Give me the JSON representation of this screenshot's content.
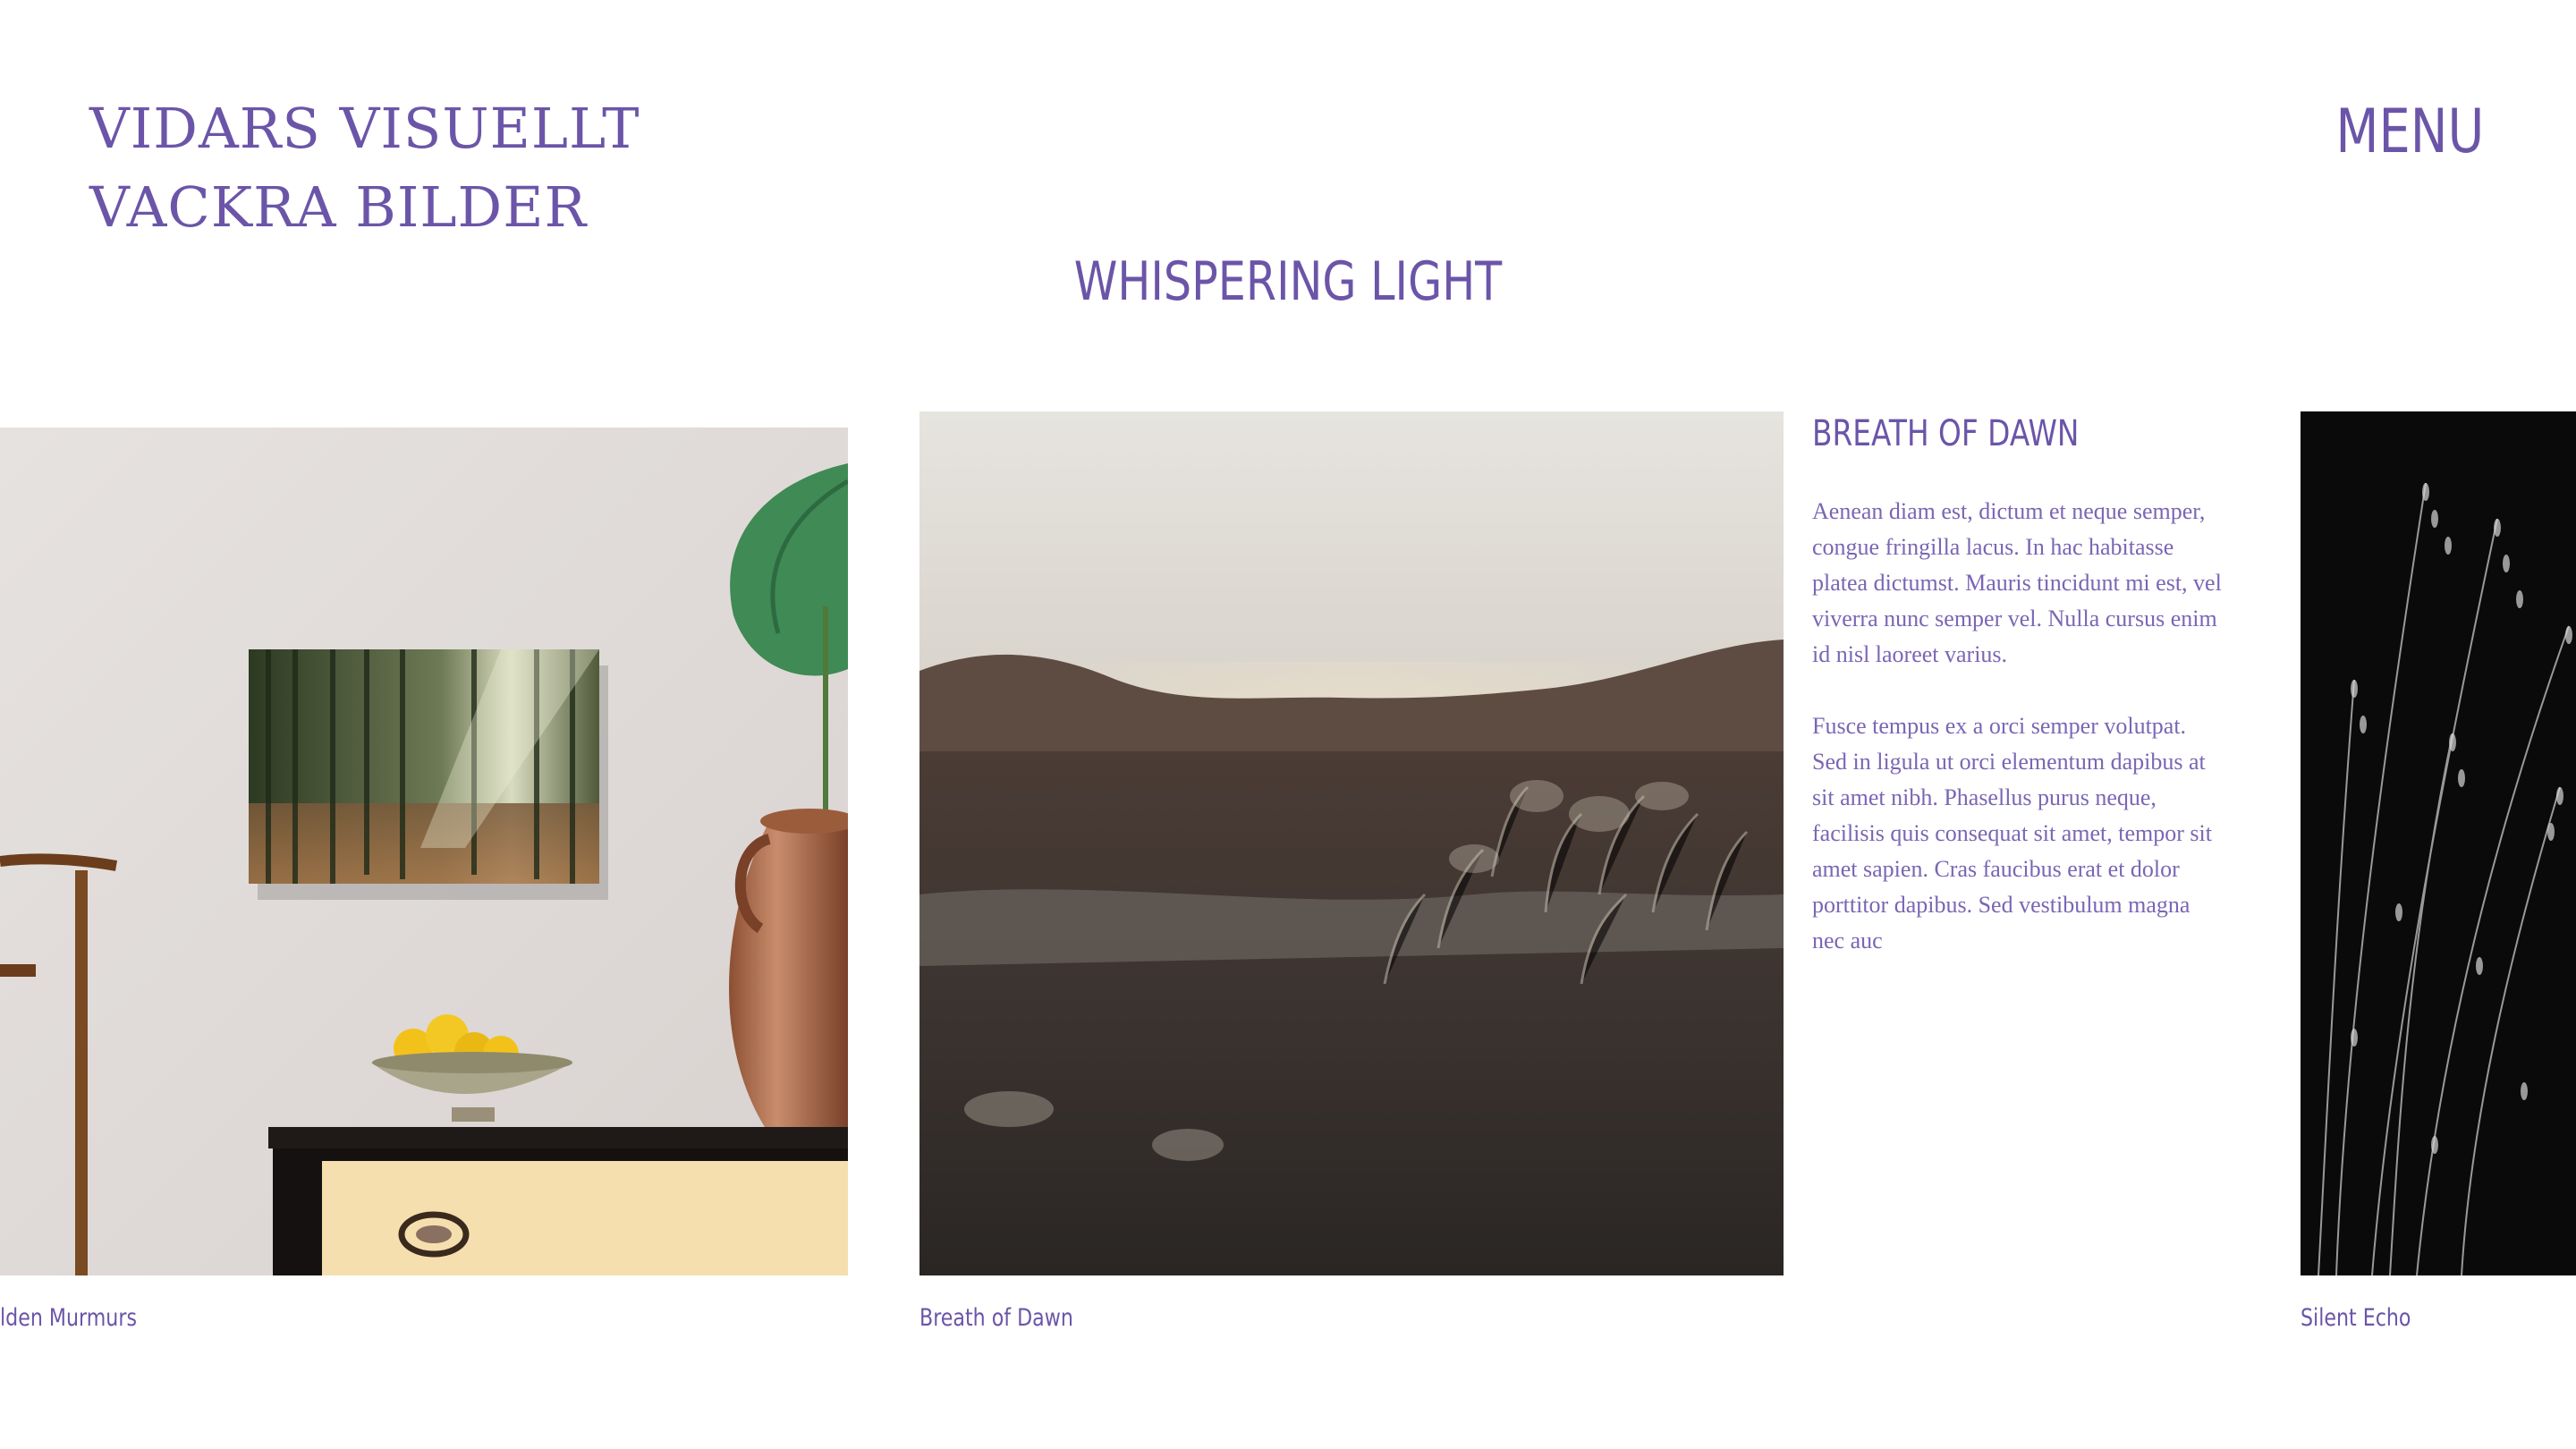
{
  "brand": {
    "line1": "VIDARS VISUELLT",
    "line2": "VACKRA BILDER"
  },
  "menu_label": "MENU",
  "page_title": "WHISPERING LIGHT",
  "gallery": {
    "items": [
      {
        "caption": "lden Murmurs"
      },
      {
        "caption": "Breath of Dawn"
      },
      {
        "caption": "Silent Echo"
      }
    ]
  },
  "detail": {
    "title": "BREATH OF DAWN",
    "paragraphs": [
      "Aenean diam est, dictum et neque semper, congue fringilla lacus. In hac habitasse platea dictumst. Mauris tincidunt mi est, vel viverra nunc semper vel. Nulla cursus enim id nisl laoreet varius.",
      "Fusce tempus ex a orci semper volutpat. Sed in ligula ut orci elementum dapibus at sit amet nibh. Phasellus purus neque, facilisis quis consequat sit amet, tempor sit amet sapien. Cras faucibus erat et dolor porttitor dapibus. Sed vestibulum magna nec auc"
    ]
  },
  "colors": {
    "accent": "#6b55a8",
    "background": "#ffffff"
  }
}
